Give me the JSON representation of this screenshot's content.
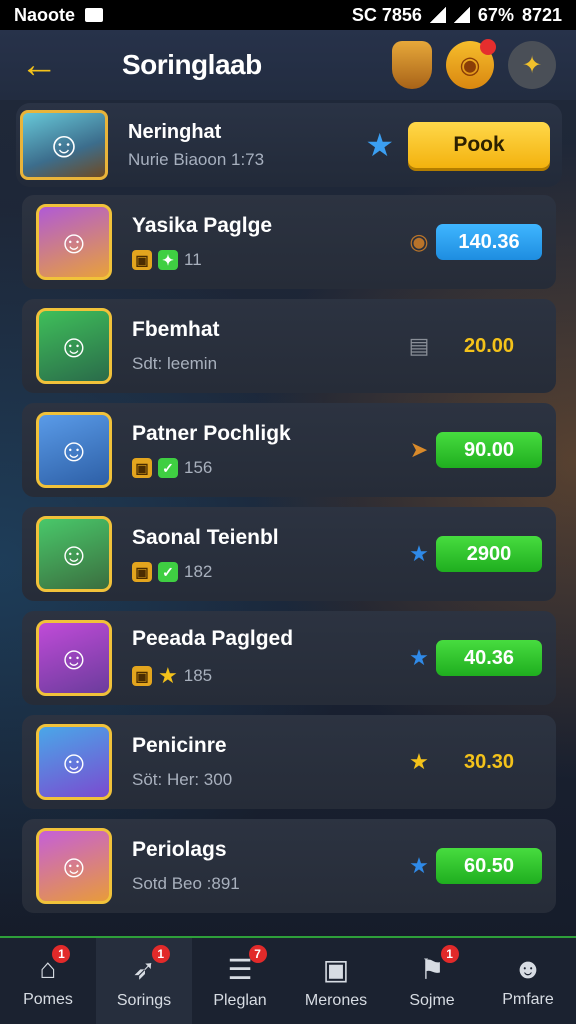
{
  "status": {
    "carrier": "Naoote",
    "right_text": "SC 7856",
    "battery": "67%",
    "time": "8721"
  },
  "header": {
    "title": "Soringlaab"
  },
  "user": {
    "name": "Neringhat",
    "subtitle": "Nurie Biaoon 1:73",
    "button_label": "Pook"
  },
  "rows": [
    {
      "name": "Yasika Paglge",
      "meta": "11",
      "value": "140.36",
      "pill": "blue",
      "value_icon": "coin-icon",
      "chips": [
        "gold",
        "green"
      ]
    },
    {
      "name": "Fbemhat",
      "meta": "Sdt: leemin",
      "value": "20.00",
      "pill": "plain",
      "value_icon": "box-icon",
      "chips": []
    },
    {
      "name": "Patner Pochligk",
      "meta": "156",
      "value": "90.00",
      "pill": "green",
      "value_icon": "arrow-icon",
      "chips": [
        "gold",
        "check"
      ]
    },
    {
      "name": "Saonal Teienbl",
      "meta": "182",
      "value": "2900",
      "pill": "green",
      "value_icon": "star-icon",
      "chips": [
        "gold",
        "check"
      ]
    },
    {
      "name": "Peeada Paglged",
      "meta": "185",
      "value": "40.36",
      "pill": "green",
      "value_icon": "star-icon",
      "chips": [
        "gold",
        "star"
      ]
    },
    {
      "name": "Penicinre",
      "meta": "Söt: Her: 300",
      "value": "30.30",
      "pill": "plain",
      "value_icon": "star-icon",
      "chips": []
    },
    {
      "name": "Periolags",
      "meta": "Sotd Beo :891",
      "value": "60.50",
      "pill": "green",
      "value_icon": "star-icon",
      "chips": []
    }
  ],
  "nav": [
    {
      "label": "Pomes",
      "icon": "home-icon",
      "badge": "1"
    },
    {
      "label": "Sorings",
      "icon": "rocket-icon",
      "badge": "1"
    },
    {
      "label": "Pleglan",
      "icon": "document-icon",
      "badge": "7"
    },
    {
      "label": "Merones",
      "icon": "camera-icon",
      "badge": ""
    },
    {
      "label": "Sojme",
      "icon": "tag-icon",
      "badge": "1"
    },
    {
      "label": "Pmfare",
      "icon": "person-icon",
      "badge": ""
    }
  ]
}
